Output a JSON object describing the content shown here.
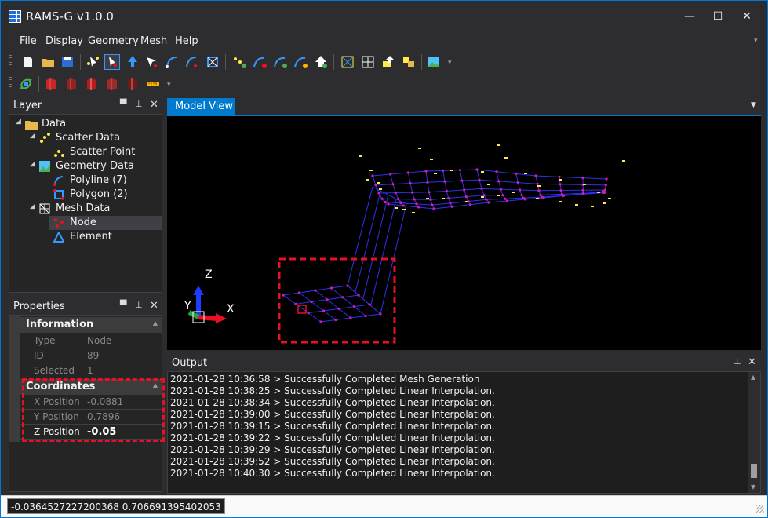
{
  "app": {
    "title": "RAMS-G v1.0.0",
    "window_buttons": {
      "minimize": "—",
      "maximize": "☐",
      "close": "✕"
    }
  },
  "menu": [
    "File",
    "Display",
    "Geometry",
    "Mesh",
    "Help"
  ],
  "toolbar1_icons": [
    "new-file-icon",
    "open-folder-icon",
    "save-icon",
    "select-node-icon",
    "select-arrow-icon",
    "pointer-up-icon",
    "pointer-diag-icon",
    "path-icon",
    "path-select-icon",
    "node-box-icon",
    "scatter-add-icon",
    "curve-icon",
    "curve-alt-icon",
    "curve-edit-icon",
    "point-move-icon",
    "mesh-fit-icon",
    "mesh-grid-icon",
    "mesh-import-icon",
    "mesh-export-icon",
    "image-icon"
  ],
  "toolbar2_icons": [
    "refresh-icon",
    "cube-red-1-icon",
    "cube-red-2-icon",
    "cube-red-3-icon",
    "cube-red-4-icon",
    "cube-red-5-icon",
    "ruler-icon"
  ],
  "layer_panel": {
    "title": "Layer",
    "tree": [
      {
        "label": "Data",
        "icon": "folder-icon"
      },
      {
        "label": "Scatter Data",
        "icon": "scatter-data-icon"
      },
      {
        "label": "Scatter Point",
        "icon": "scatter-point-icon"
      },
      {
        "label": "Geometry Data",
        "icon": "geometry-data-icon"
      },
      {
        "label": "Polyline (7)",
        "icon": "polyline-icon"
      },
      {
        "label": "Polygon (2)",
        "icon": "polygon-icon"
      },
      {
        "label": "Mesh Data",
        "icon": "mesh-data-icon"
      },
      {
        "label": "Node",
        "icon": "node-icon"
      },
      {
        "label": "Element",
        "icon": "element-icon"
      }
    ]
  },
  "properties_panel": {
    "title": "Properties",
    "information": {
      "header": "Information",
      "rows": [
        {
          "key": "Type",
          "value": "Node"
        },
        {
          "key": "ID",
          "value": "89"
        },
        {
          "key": "Selected",
          "value": "1"
        }
      ]
    },
    "coordinates": {
      "header": "Coordinates",
      "rows": [
        {
          "key": "X Position",
          "value": "-0.0881"
        },
        {
          "key": "Y Position",
          "value": "0.7896"
        },
        {
          "key": "Z Position",
          "value": "-0.05"
        }
      ]
    }
  },
  "model_view": {
    "tab": "Model View",
    "axes": {
      "z": "Z",
      "y": "Y",
      "x": "X"
    },
    "colors": {
      "mesh": "#2f2ff0",
      "node": "#d81bb0",
      "scatter": "#ffe94d",
      "highlight": "#e81123"
    }
  },
  "output_panel": {
    "title": "Output",
    "lines": [
      "2021-01-28 10:36:58 > Successfully Completed Mesh Generation",
      "2021-01-28 10:38:25 > Successfully Completed Linear Interpolation.",
      "2021-01-28 10:38:34 > Successfully Completed Linear Interpolation.",
      "2021-01-28 10:39:00 > Successfully Completed Linear Interpolation.",
      "2021-01-28 10:39:15 > Successfully Completed Linear Interpolation.",
      "2021-01-28 10:39:22 > Successfully Completed Linear Interpolation.",
      "2021-01-28 10:39:29 > Successfully Completed Linear Interpolation.",
      "2021-01-28 10:39:52 > Successfully Completed Linear Interpolation.",
      "2021-01-28 10:40:30 > Successfully Completed Linear Interpolation."
    ]
  },
  "status": {
    "coordinates": "-0.0364527227200368 0.706691395402053"
  }
}
